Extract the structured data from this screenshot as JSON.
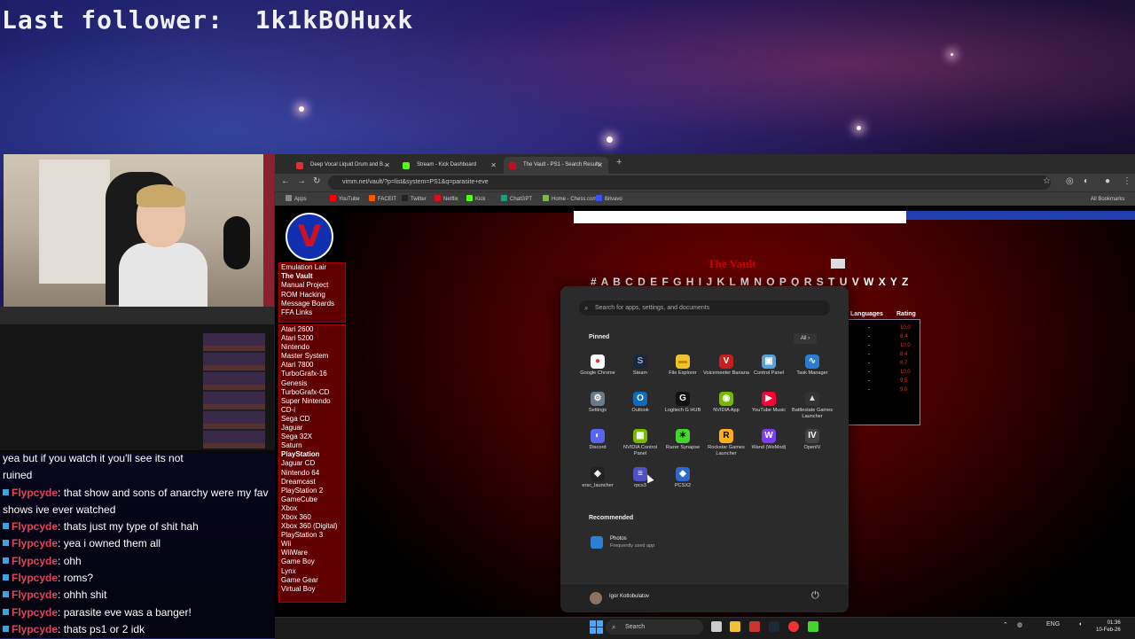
{
  "overlay": {
    "last_follower": "Last follower:  1k1kBOHuxk"
  },
  "chat": {
    "messages": [
      {
        "user": "",
        "text": "yea but if you watch it you'll see its not"
      },
      {
        "user": "",
        "text": "ruined"
      },
      {
        "user": "Flypcyde",
        "text": ": that show and sons of anarchy were my fav"
      },
      {
        "user": "",
        "text": "shows ive ever watched"
      },
      {
        "user": "Flypcyde",
        "text": ": thats just my type of shit hah"
      },
      {
        "user": "Flypcyde",
        "text": ": yea i owned them all"
      },
      {
        "user": "Flypcyde",
        "text": ": ohh"
      },
      {
        "user": "Flypcyde",
        "text": ": roms?"
      },
      {
        "user": "Flypcyde",
        "text": ": ohhh shit"
      },
      {
        "user": "Flypcyde",
        "text": ": parasite eve was a banger!"
      },
      {
        "user": "Flypcyde",
        "text": ": thats ps1 or 2 idk"
      }
    ]
  },
  "browser": {
    "tabs": [
      {
        "label": "Deep Vocal Liquid Drum and B…",
        "color": "#e03030"
      },
      {
        "label": "Stream - Kick Dashboard",
        "color": "#53fc18"
      },
      {
        "label": "The Vault - PS1 - Search Results",
        "color": "#c01020"
      }
    ],
    "url": "vimm.net/vault/?p=list&system=PS1&q=parasite+eve",
    "bookmarks": [
      {
        "label": "Apps",
        "color": "#888"
      },
      {
        "label": "YouTube",
        "color": "#ff0000"
      },
      {
        "label": "FACEIT",
        "color": "#ff5500"
      },
      {
        "label": "Twitter",
        "color": "#222"
      },
      {
        "label": "Netflix",
        "color": "#e50914"
      },
      {
        "label": "Kick",
        "color": "#53fc18"
      },
      {
        "label": "ChatGPT",
        "color": "#10a37f"
      },
      {
        "label": "Home - Chess.com",
        "color": "#81b64c"
      },
      {
        "label": "Bitvavo",
        "color": "#3355ff"
      }
    ],
    "all_bookmarks": "All Bookmarks"
  },
  "vault": {
    "logo": "V",
    "title": "The Vault",
    "menu": [
      "Emulation Lair",
      "The Vault",
      "Manual Project",
      "ROM Hacking",
      "Message Boards",
      "FFA Links"
    ],
    "consoles": [
      "Atari 2600",
      "Atari 5200",
      "Nintendo",
      "Master System",
      "Atari 7800",
      "TurboGrafx-16",
      "Genesis",
      "TurboGrafx-CD",
      "Super Nintendo",
      "CD-i",
      "Sega CD",
      "Jaguar",
      "Sega 32X",
      "Saturn",
      "PlayStation",
      "Jaguar CD",
      "Nintendo 64",
      "Dreamcast",
      "PlayStation 2",
      "GameCube",
      "Xbox",
      "Xbox 360",
      "Xbox 360 (Digital)",
      "PlayStation 3",
      "Wii",
      "WiiWare",
      "Game Boy",
      "Lynx",
      "Game Gear",
      "Virtual Boy"
    ],
    "alphabet": "# A B C D E F G H I J K L M N O P Q R S T U V W X Y Z",
    "columns": {
      "languages": "Languages",
      "rating": "Rating"
    },
    "ratings": [
      "10.0",
      "8.4",
      "10.0",
      "8.4",
      "8.7",
      "10.0",
      "9.5",
      "9.0"
    ]
  },
  "start_menu": {
    "search_placeholder": "Search for apps, settings, and documents",
    "pinned_label": "Pinned",
    "all_label": "All",
    "apps": [
      {
        "label": "Google Chrome",
        "color": "#ffffff",
        "glyph": "●",
        "fg": "#e33"
      },
      {
        "label": "Steam",
        "color": "#1b2838",
        "glyph": "S",
        "fg": "#9ad"
      },
      {
        "label": "File Explorer",
        "color": "#f2c12e",
        "glyph": "▬",
        "fg": "#c88a00"
      },
      {
        "label": "Voicemeeter Banana",
        "color": "#c42020",
        "glyph": "V",
        "fg": "#fff"
      },
      {
        "label": "Control Panel",
        "color": "#5aa0d8",
        "glyph": "▣",
        "fg": "#fff"
      },
      {
        "label": "Task Manager",
        "color": "#2a7bd1",
        "glyph": "∿",
        "fg": "#fff"
      },
      {
        "label": "Settings",
        "color": "#6b7a8a",
        "glyph": "⚙",
        "fg": "#fff"
      },
      {
        "label": "Outlook",
        "color": "#0f6cbd",
        "glyph": "O",
        "fg": "#fff"
      },
      {
        "label": "Logitech G HUB",
        "color": "#111111",
        "glyph": "G",
        "fg": "#fff"
      },
      {
        "label": "NVIDIA App",
        "color": "#76b900",
        "glyph": "◉",
        "fg": "#fff"
      },
      {
        "label": "YouTube Music",
        "color": "#ff0033",
        "glyph": "▶",
        "fg": "#fff"
      },
      {
        "label": "Battlestate Games Launcher",
        "color": "#333333",
        "glyph": "▲",
        "fg": "#ddd"
      },
      {
        "label": "Discord",
        "color": "#5865f2",
        "glyph": "◐",
        "fg": "#fff"
      },
      {
        "label": "NVIDIA Control Panel",
        "color": "#76b900",
        "glyph": "▦",
        "fg": "#fff"
      },
      {
        "label": "Razer Synapse",
        "color": "#44d62c",
        "glyph": "✶",
        "fg": "#000"
      },
      {
        "label": "Rockstar Games Launcher",
        "color": "#fcaf17",
        "glyph": "R",
        "fg": "#000"
      },
      {
        "label": "Wand (WeMod)",
        "color": "#7b3ff2",
        "glyph": "W",
        "fg": "#fff"
      },
      {
        "label": "OpenIV",
        "color": "#444444",
        "glyph": "IV",
        "fg": "#fff"
      },
      {
        "label": "ersc_launcher",
        "color": "#222222",
        "glyph": "◈",
        "fg": "#fff"
      },
      {
        "label": "rpcs3",
        "color": "#5050c0",
        "glyph": "≡",
        "fg": "#fff"
      },
      {
        "label": "PCSX2",
        "color": "#3068c8",
        "glyph": "◆",
        "fg": "#fff"
      }
    ],
    "recommended_label": "Recommended",
    "recommended": {
      "name": "Photos",
      "sub": "Frequently used app"
    },
    "user": "Igor Kotlobulatov"
  },
  "taskbar": {
    "search_label": "Search",
    "lang": "ENG",
    "time": "01:36",
    "date": "10-Feb-26"
  }
}
